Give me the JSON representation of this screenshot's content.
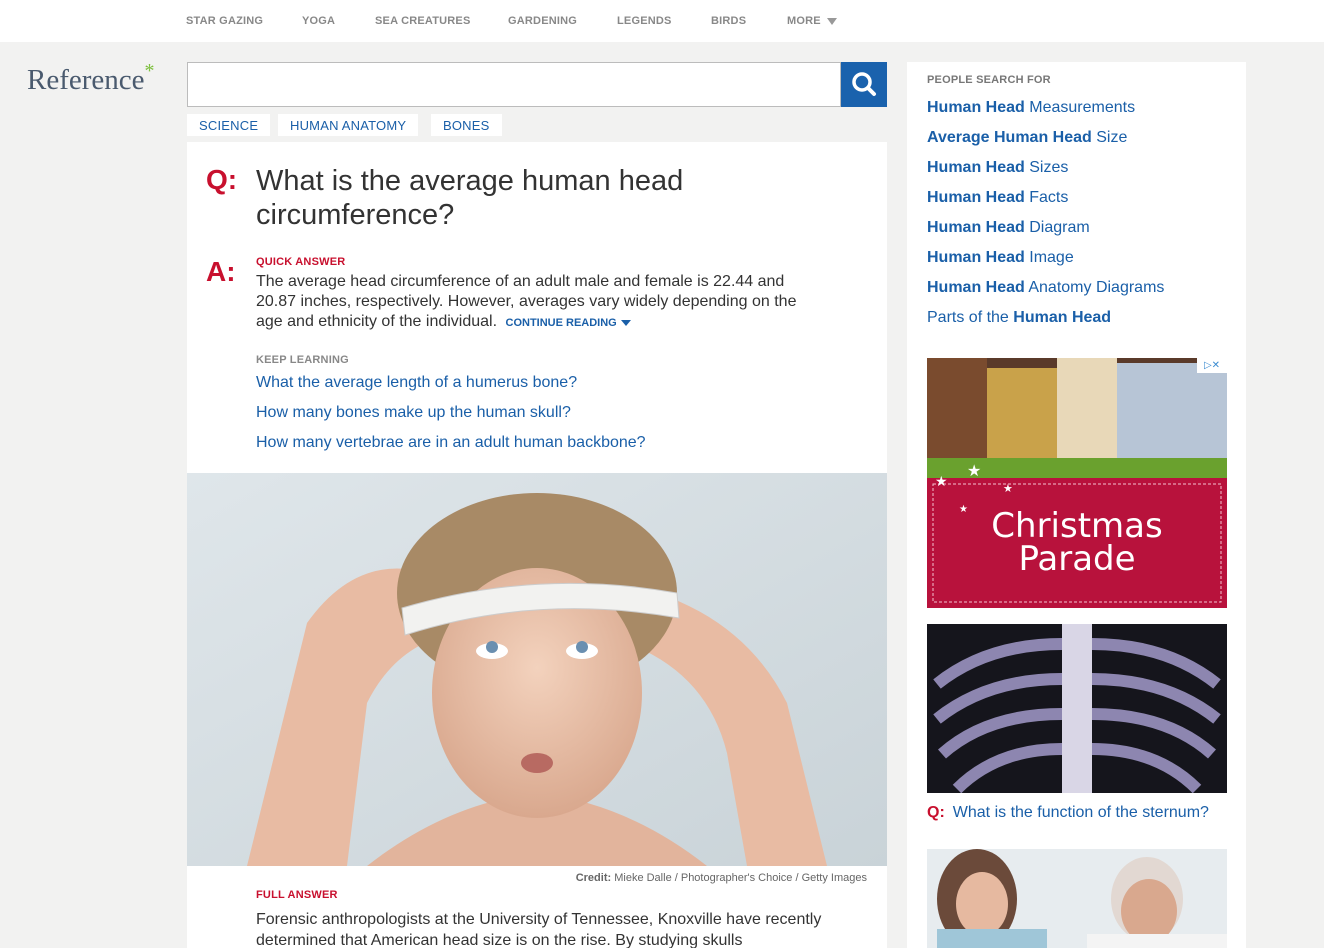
{
  "topnav": {
    "items": [
      "STAR GAZING",
      "YOGA",
      "SEA CREATURES",
      "GARDENING",
      "LEGENDS",
      "BIRDS",
      "MORE"
    ]
  },
  "logo": {
    "text": "Reference",
    "mark": "*"
  },
  "search": {
    "placeholder": "",
    "button_icon": "search-icon"
  },
  "breadcrumbs": [
    "SCIENCE",
    "HUMAN ANATOMY",
    "BONES"
  ],
  "question": {
    "q_label": "Q:",
    "text": "What is the average human head circumference?",
    "a_label": "A:",
    "quick_answer_label": "QUICK ANSWER",
    "quick_answer": "The average head circumference of an adult male and female is 22.44 and 20.87 inches, respectively. However, averages vary widely depending on the age and ethnicity of the individual.",
    "continue_label": "CONTINUE READING",
    "keep_learning_label": "KEEP LEARNING",
    "keep_learning": [
      "What the average length of a humerus bone?",
      "How many bones make up the human skull?",
      "How many vertebrae are in an adult human backbone?"
    ],
    "credit_label": "Credit:",
    "credit_text": "Mieke Dalle / Photographer's Choice / Getty Images",
    "full_answer_label": "FULL ANSWER",
    "full_answer": "Forensic anthropologists at the University of Tennessee, Knoxville have recently determined that American head size is on the rise. By studying skulls"
  },
  "sidebar": {
    "title": "PEOPLE SEARCH FOR",
    "links": [
      {
        "bold": "Human Head",
        "rest": " Measurements",
        "pre": ""
      },
      {
        "bold": "Average Human Head",
        "rest": " Size",
        "pre": ""
      },
      {
        "bold": "Human Head",
        "rest": " Sizes",
        "pre": ""
      },
      {
        "bold": "Human Head",
        "rest": " Facts",
        "pre": ""
      },
      {
        "bold": "Human Head",
        "rest": " Diagram",
        "pre": ""
      },
      {
        "bold": "Human Head",
        "rest": " Image",
        "pre": ""
      },
      {
        "bold": "Human Head",
        "rest": " Anatomy Diagrams",
        "pre": ""
      },
      {
        "bold": "Human Head",
        "rest": "",
        "pre": "Parts of the "
      }
    ],
    "ad_line1": "Christmas",
    "ad_line2": "Parade",
    "ad_badge": "▷✕",
    "promo_q_label": "Q:",
    "promo_q": "What is the function of the sternum?"
  },
  "colors": {
    "accent_red": "#c8102e",
    "link_blue": "#1a5fa8",
    "search_blue": "#1a62ad"
  }
}
